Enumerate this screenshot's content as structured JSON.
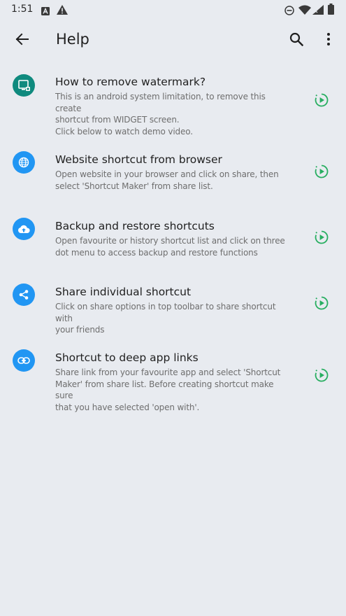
{
  "status_bar": {
    "time": "1:51",
    "icons": [
      "a11y-notification-icon",
      "alert-triangle-icon",
      "do-not-disturb-icon",
      "wifi-icon",
      "signal-icon",
      "battery-icon"
    ]
  },
  "app_bar": {
    "title": "Help",
    "back_icon": "arrow-back-icon",
    "search_icon": "search-icon",
    "menu_icon": "more-vert-icon"
  },
  "colors": {
    "background": "#e8ebf0",
    "icon_teal": "#0f8a7e",
    "icon_blue": "#2196f3",
    "play_green": "#27ae60",
    "title_text": "#1f1f1f",
    "desc_text": "#6e6e6e"
  },
  "items": [
    {
      "title": "How to remove watermark?",
      "desc_lines": [
        "This is an android system limitation, to remove this create",
        "shortcut from WIDGET screen.",
        "Click below to watch demo video."
      ],
      "icon": "widget-screen-icon",
      "action_icon": "play-circle-icon"
    },
    {
      "title": "Website shortcut from browser",
      "desc_lines": [
        "Open website in your browser and click on share, then",
        "select 'Shortcut Maker' from share list."
      ],
      "icon": "globe-icon",
      "action_icon": "play-circle-icon"
    },
    {
      "title": "Backup and restore shortcuts",
      "desc_lines": [
        "Open favourite or history shortcut list and click on three",
        "dot menu to access backup and restore functions"
      ],
      "icon": "cloud-upload-icon",
      "action_icon": "play-circle-icon"
    },
    {
      "title": "Share individual shortcut",
      "desc_lines": [
        "Click on share options in top toolbar to share shortcut with",
        "your friends"
      ],
      "icon": "share-icon",
      "action_icon": "play-circle-icon"
    },
    {
      "title": "Shortcut to deep app links",
      "desc_lines": [
        "Share link from your favourite app and select 'Shortcut",
        "Maker' from share list. Before creating shortcut make sure",
        "that you have selected 'open with'."
      ],
      "icon": "link-icon",
      "action_icon": "play-circle-icon"
    }
  ]
}
